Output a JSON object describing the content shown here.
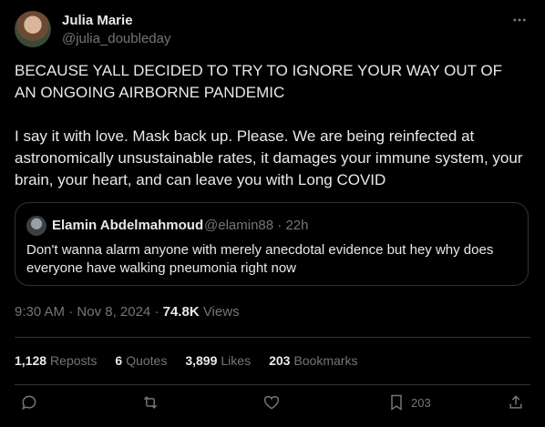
{
  "author": {
    "name": "Julia Marie",
    "handle": "@julia_doubleday"
  },
  "tweet": {
    "text": "BECAUSE YALL DECIDED TO TRY TO IGNORE YOUR WAY OUT OF AN ONGOING AIRBORNE PANDEMIC\n\nI say it with love. Mask back up. Please. We are being reinfected at astronomically unsustainable rates, it damages your immune system, your brain, your heart, and can leave you with Long COVID"
  },
  "quote": {
    "name": "Elamin Abdelmahmoud",
    "handle": "@elamin88",
    "separator": "·",
    "time": "22h",
    "text": "Don't wanna alarm anyone with merely anecdotal evidence but hey why does everyone have walking pneumonia right now"
  },
  "meta": {
    "time": "9:30 AM",
    "dot1": "·",
    "date": "Nov 8, 2024",
    "dot2": "·",
    "views_count": "74.8K",
    "views_label": "Views"
  },
  "stats": [
    {
      "count": "1,128",
      "label": "Reposts"
    },
    {
      "count": "6",
      "label": "Quotes"
    },
    {
      "count": "3,899",
      "label": "Likes"
    },
    {
      "count": "203",
      "label": "Bookmarks"
    }
  ],
  "actions": {
    "bookmark_count": "203"
  },
  "icons": [
    "more-icon",
    "reply-icon",
    "repost-icon",
    "like-icon",
    "bookmark-icon",
    "share-icon"
  ],
  "colors": {
    "background": "#000000",
    "text": "#e7e9ea",
    "muted": "#71767b",
    "border": "#2f3336"
  }
}
